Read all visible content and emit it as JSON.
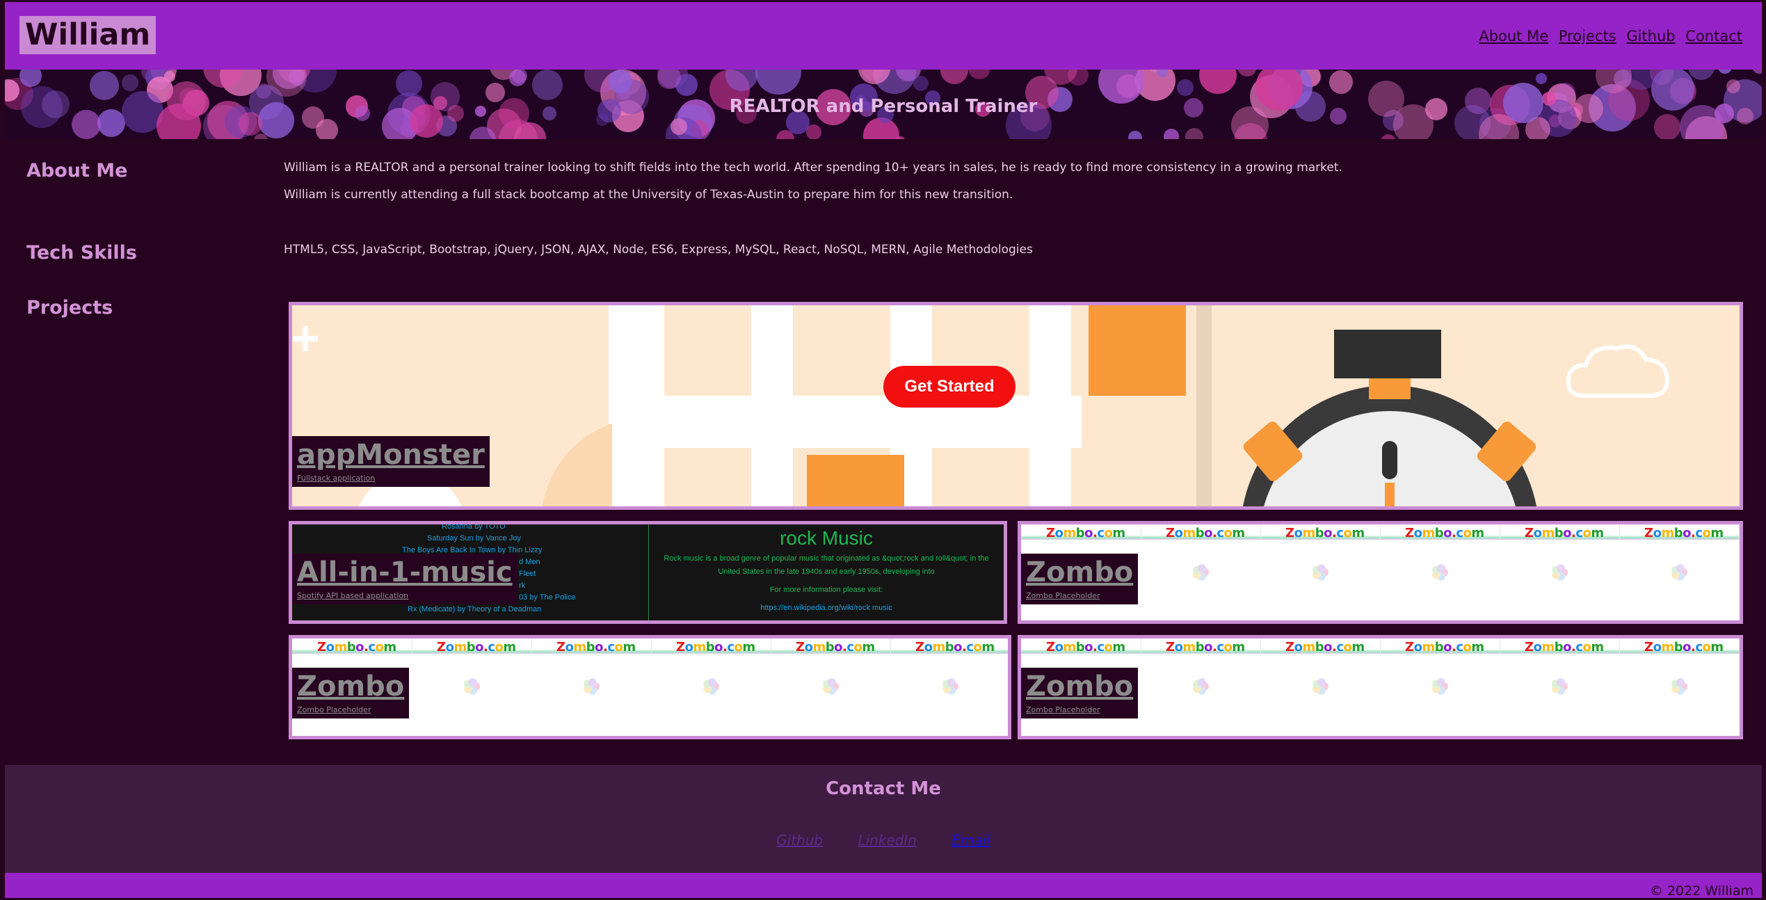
{
  "header": {
    "brand": "William",
    "nav": [
      "About Me",
      "Projects",
      "Github",
      "Contact"
    ]
  },
  "hero": {
    "title": "REALTOR and Personal Trainer"
  },
  "about": {
    "title": "About Me",
    "p1": "William is a REALTOR and a personal trainer looking to shift fields into the tech world. After spending 10+ years in sales, he is ready to find more consistency in a growing market.",
    "p2": "William is currently attending a full stack bootcamp at the University of Texas-Austin to prepare him for this new transition."
  },
  "skills": {
    "title": "Tech Skills",
    "text": "HTML5, CSS, JavaScript, Bootstrap, jQuery, JSON, AJAX, Node, ES6, Express, MySQL, React, NoSQL, MERN, Agile Methodologies"
  },
  "projects": {
    "title": "Projects",
    "items": [
      {
        "title": "appMonster",
        "subtitle": "Fullstack application",
        "cta": "Get Started"
      },
      {
        "title": "All-in-1-music",
        "subtitle": "Spotify API based application",
        "genre_heading": "rock Music",
        "genre_text": "Rock music is a broad genre of popular music that originated as &quot;rock and roll&quot; in the United States in the late 1940s and early 1950s, developing into",
        "more_info": "For more information please visit:",
        "link": "https://en.wikipedia.org/wiki/rock music",
        "tracks": [
          "Rosanna by TOTO",
          "Saturday Sun by Vance Joy",
          "The Boys Are Back In Town by Thin Lizzy",
          "d Men",
          "Fleet",
          "rk",
          "03 by The Police",
          "Rx (Medicate) by Theory of a Deadman"
        ]
      },
      {
        "title": "Zombo",
        "subtitle": "Zombo Placeholder",
        "banner": "Zombo.com"
      },
      {
        "title": "Zombo",
        "subtitle": "Zombo Placeholder",
        "banner": "Zombo.com"
      },
      {
        "title": "Zombo",
        "subtitle": "Zombo Placeholder",
        "banner": "Zombo.com"
      }
    ]
  },
  "contact": {
    "title": "Contact Me",
    "links": [
      "Github",
      "LinkedIn",
      "Email"
    ]
  },
  "footer": {
    "copyright": "© 2022 William"
  },
  "colors": {
    "header": "#9523c8",
    "background": "#26041f",
    "accent": "#c98ad3",
    "contact_bg": "#3e1b41"
  }
}
